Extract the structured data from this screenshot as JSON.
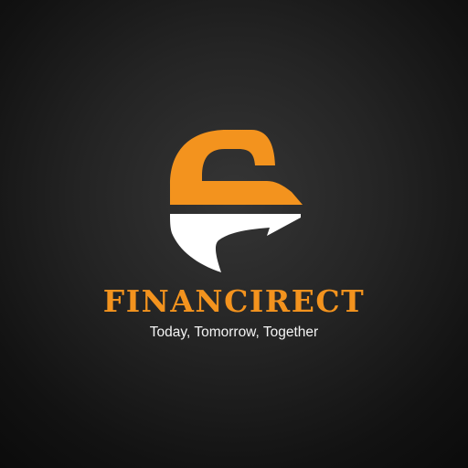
{
  "brand": {
    "name": "FINANCIRECT",
    "tagline": "Today, Tomorrow, Together",
    "icon": "financirect-logo-mark-icon"
  },
  "colors": {
    "background": "#1f1f1f",
    "accent": "#f3931e",
    "secondary": "#ffffff"
  }
}
